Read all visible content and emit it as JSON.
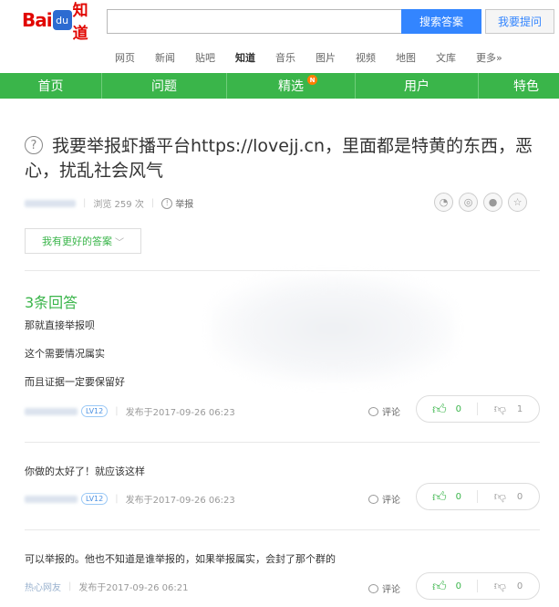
{
  "header": {
    "logo_text": "Bai",
    "logo_paw": "du",
    "logo_zhidao": "知道",
    "search_placeholder": "",
    "search_button": "搜索答案",
    "ask_button": "我要提问"
  },
  "channels": [
    {
      "label": "网页",
      "active": false
    },
    {
      "label": "新闻",
      "active": false
    },
    {
      "label": "贴吧",
      "active": false
    },
    {
      "label": "知道",
      "active": true
    },
    {
      "label": "音乐",
      "active": false
    },
    {
      "label": "图片",
      "active": false
    },
    {
      "label": "视频",
      "active": false
    },
    {
      "label": "地图",
      "active": false
    },
    {
      "label": "文库",
      "active": false
    },
    {
      "label": "更多»",
      "active": false
    }
  ],
  "green_nav": [
    {
      "label": "首页"
    },
    {
      "label": "问题"
    },
    {
      "label": "精选",
      "badge": "N"
    },
    {
      "label": "用户"
    },
    {
      "label": "特色"
    }
  ],
  "question": {
    "icon": "question-circle-icon",
    "title": "我要举报虾播平台https://lovejj.cn，里面都是特黄的东西，恶心，扰乱社会风气",
    "views": "浏览 259 次",
    "report": "举报",
    "better_answer_button": "我有更好的答案"
  },
  "share_icons": [
    "wechat-icon",
    "weibo-icon",
    "qq-icon",
    "qzone-star-icon"
  ],
  "answers_count_label": "3条回答",
  "answers": [
    {
      "lines": [
        "那就直接举报呗",
        "这个需要情况属实",
        "而且证据一定要保留好"
      ],
      "level": "LV12",
      "posted": "发布于2017-09-26 06:23",
      "comment_label": "评论",
      "up": "0",
      "down": "1"
    },
    {
      "lines": [
        "你做的太好了！就应该这样"
      ],
      "level": "LV12",
      "posted": "发布于2017-09-26 06:23",
      "comment_label": "评论",
      "up": "0",
      "down": "0"
    },
    {
      "lines": [
        "可以举报的。他也不知道是谁举报的，如果举报属实，会封了那个群的"
      ],
      "author": "热心网友",
      "posted": "发布于2017-09-26 06:21",
      "comment_label": "评论",
      "up": "0",
      "down": "0"
    }
  ],
  "colors": {
    "green": "#3ab54a",
    "blue": "#3385ff",
    "red": "#e10601"
  }
}
